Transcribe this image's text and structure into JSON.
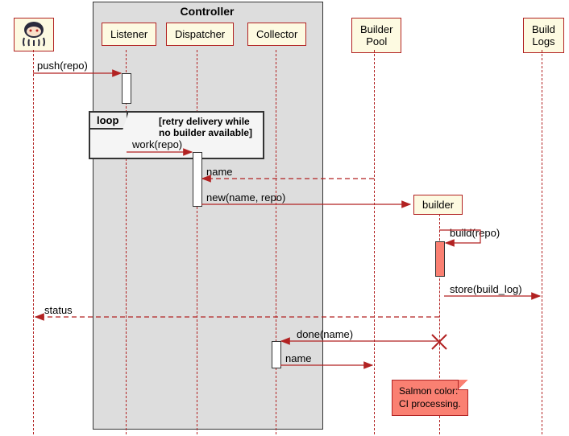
{
  "group": {
    "title": "Controller"
  },
  "participants": {
    "github_actor": {
      "icon": "octocat"
    },
    "listener": {
      "label": "Listener"
    },
    "dispatcher": {
      "label": "Dispatcher"
    },
    "collector": {
      "label": "Collector"
    },
    "builder_pool": {
      "label": "Builder\nPool"
    },
    "build_logs": {
      "label": "Build\nLogs"
    },
    "builder": {
      "label": "builder"
    }
  },
  "fragment": {
    "type": "loop",
    "label": "loop",
    "condition": "[retry delivery while\nno builder available]"
  },
  "messages": {
    "m1": "push(repo)",
    "m2": "work(repo)",
    "m3": "name",
    "m4": "new(name, repo)",
    "m5": "build(repo)",
    "m6": "store(build_log)",
    "m7": "status",
    "m8": "done(name)",
    "m9": "name"
  },
  "note": {
    "text": "Salmon color:\nCI processing."
  },
  "chart_data": {
    "type": "sequence_diagram",
    "participants": [
      {
        "id": "github",
        "kind": "actor",
        "icon": "octocat"
      },
      {
        "id": "listener",
        "label": "Listener",
        "group": "Controller"
      },
      {
        "id": "dispatcher",
        "label": "Dispatcher",
        "group": "Controller"
      },
      {
        "id": "collector",
        "label": "Collector",
        "group": "Controller"
      },
      {
        "id": "builder_pool",
        "label": "Builder Pool"
      },
      {
        "id": "build_logs",
        "label": "Build Logs"
      },
      {
        "id": "builder",
        "label": "builder",
        "created_by": "dispatcher"
      }
    ],
    "groups": [
      {
        "name": "Controller",
        "members": [
          "listener",
          "dispatcher",
          "collector"
        ]
      }
    ],
    "messages": [
      {
        "from": "github",
        "to": "listener",
        "label": "push(repo)",
        "type": "sync"
      },
      {
        "fragment": "loop",
        "condition": "retry delivery while no builder available",
        "messages": [
          {
            "from": "listener",
            "to": "dispatcher",
            "label": "work(repo)",
            "type": "sync"
          }
        ]
      },
      {
        "from": "builder_pool",
        "to": "dispatcher",
        "label": "name",
        "type": "return"
      },
      {
        "from": "dispatcher",
        "to": "builder",
        "label": "new(name, repo)",
        "type": "create"
      },
      {
        "from": "builder",
        "to": "builder",
        "label": "build(repo)",
        "type": "self",
        "activation_color": "salmon"
      },
      {
        "from": "builder",
        "to": "build_logs",
        "label": "store(build_log)",
        "type": "sync"
      },
      {
        "from": "builder",
        "to": "github",
        "label": "status",
        "type": "return"
      },
      {
        "from": "builder",
        "to": "collector",
        "label": "done(name)",
        "type": "sync",
        "destroy_source": true
      },
      {
        "from": "collector",
        "to": "builder_pool",
        "label": "name",
        "type": "sync"
      }
    ],
    "notes": [
      {
        "text": "Salmon color:\nCI processing.",
        "attached_to": "builder",
        "color": "salmon"
      }
    ]
  }
}
